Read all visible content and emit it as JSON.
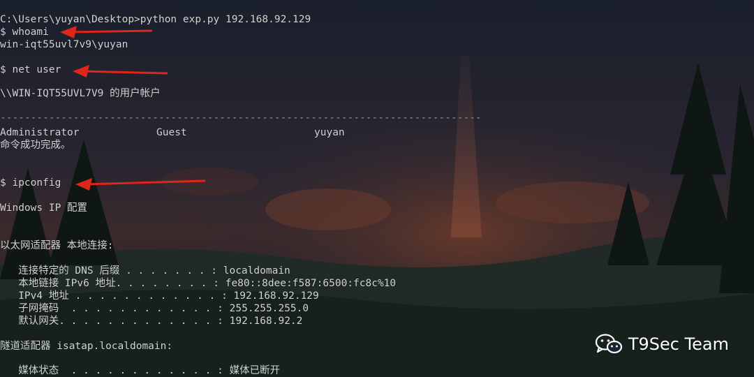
{
  "colors": {
    "terminal_text": "#d4d4d4",
    "arrow_red": "#e0251b",
    "watermark": "#ffffff"
  },
  "terminal": {
    "prompt_line": "C:\\Users\\yuyan\\Desktop>python exp.py 192.168.92.129",
    "cmd_whoami": "$ whoami",
    "out_whoami": "win-iqt55uvl7v9\\yuyan",
    "cmd_netuser": "$ net user",
    "netuser_header": "\\\\WIN-IQT55UVL7V9 的用户帐户",
    "separator": "-------------------------------------------------------------------------------",
    "users": [
      "Administrator",
      "Guest",
      "yuyan"
    ],
    "netuser_done": "命令成功完成。",
    "cmd_ipconfig": "$ ipconfig",
    "ipconfig_title": "Windows IP 配置",
    "adapter1_header": "以太网适配器 本地连接:",
    "adapter1_rows": [
      {
        "label": "   连接特定的 DNS 后缀 . . . . . . . :",
        "value": " localdomain"
      },
      {
        "label": "   本地链接 IPv6 地址. . . . . . . . :",
        "value": " fe80::8dee:f587:6500:fc8c%10"
      },
      {
        "label": "   IPv4 地址 . . . . . . . . . . . . :",
        "value": " 192.168.92.129"
      },
      {
        "label": "   子网掩码  . . . . . . . . . . . . :",
        "value": " 255.255.255.0"
      },
      {
        "label": "   默认网关. . . . . . . . . . . . . :",
        "value": " 192.168.92.2"
      }
    ],
    "adapter2_header": "隧道适配器 isatap.localdomain:",
    "adapter2_rows": [
      {
        "label": "   媒体状态  . . . . . . . . . . . . :",
        "value": " 媒体已断开"
      }
    ]
  },
  "watermark": {
    "icon": "wechat-icon",
    "text": "T9Sec Team"
  }
}
